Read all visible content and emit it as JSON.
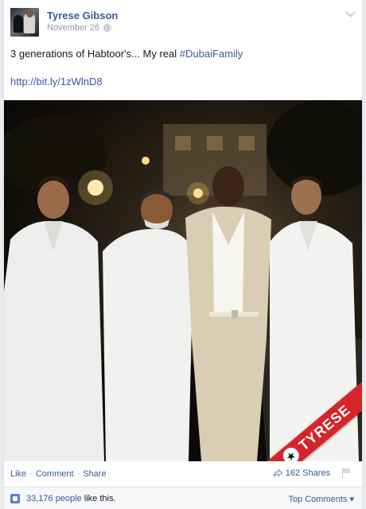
{
  "post": {
    "author": "Tyrese Gibson",
    "date": "November 26",
    "message_prefix": "3 generations of Habtoor's... My real ",
    "hashtag": "#DubaiFamily",
    "link": "http://bit.ly/1zWlnD8",
    "photo_badge": "TYRESE",
    "icons": [
      "globe-icon",
      "chevron-down-icon",
      "share-arrow-icon",
      "flag-icon",
      "like-thumb-icon"
    ]
  },
  "actions": {
    "like": "Like",
    "comment": "Comment",
    "share": "Share",
    "separator": "·",
    "shares": "162 Shares"
  },
  "likes": {
    "count": "33,176 people",
    "suffix": " like this.",
    "top_comments": "Top Comments ▾"
  },
  "colors": {
    "link": "#3b5998",
    "badge": "#d7232a",
    "meta": "#9197a3"
  }
}
